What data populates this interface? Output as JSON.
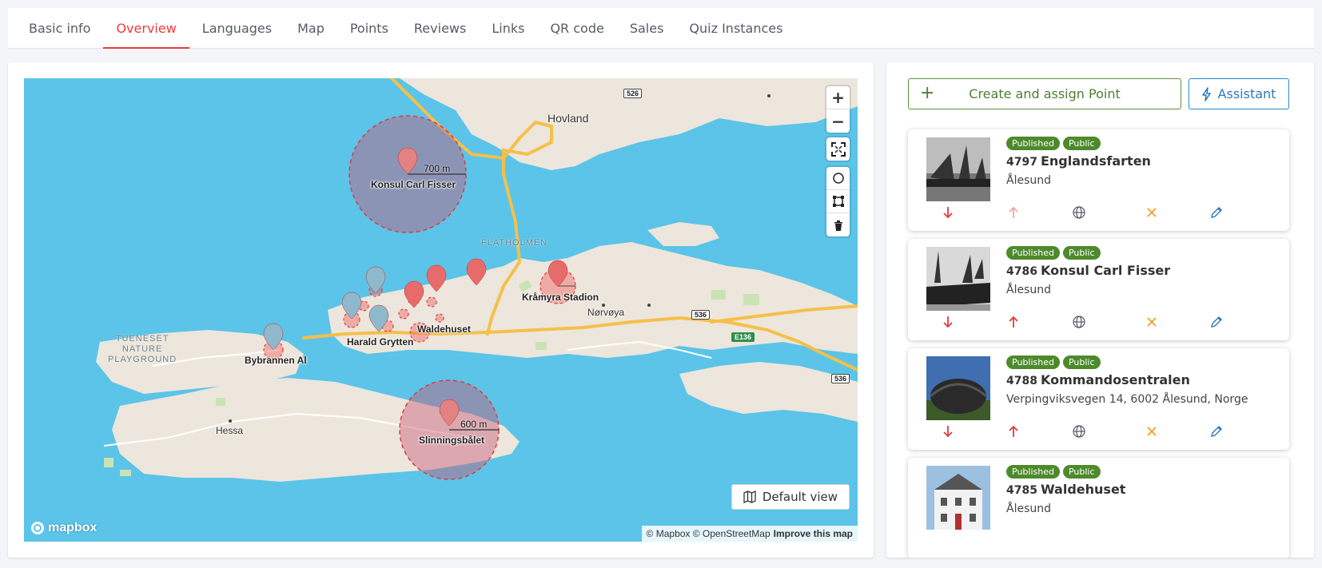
{
  "tabs": [
    {
      "label": "Basic info",
      "active": false
    },
    {
      "label": "Overview",
      "active": true
    },
    {
      "label": "Languages",
      "active": false
    },
    {
      "label": "Map",
      "active": false
    },
    {
      "label": "Points",
      "active": false
    },
    {
      "label": "Reviews",
      "active": false
    },
    {
      "label": "Links",
      "active": false
    },
    {
      "label": "QR code",
      "active": false
    },
    {
      "label": "Sales",
      "active": false
    },
    {
      "label": "Quiz Instances",
      "active": false
    }
  ],
  "map": {
    "default_view_label": "Default view",
    "attribution": "© Mapbox © OpenStreetMap",
    "improve_link": "Improve this map",
    "logo_text": "mapbox",
    "marker_labels": {
      "konsul": "Konsul Carl Fisser",
      "kramyra": "Kråmyra Stadion",
      "waldehuset": "Waldehuset",
      "harald": "Harald Grytten",
      "bybrannen": "Bybrannen Al",
      "slinning": "Slinningsbålet"
    },
    "scale_labels": {
      "konsul": "700 m",
      "slinning": "600 m"
    },
    "place_labels": {
      "hovland": "Hovland",
      "norvoya": "Nørvøya",
      "hessa": "Hessa"
    },
    "area_labels": {
      "flatholmen": "FLATHOLMEN",
      "tueneset_1": "TUENESET",
      "tueneset_2": "NATURE",
      "tueneset_3": "PLAYGROUND"
    },
    "road_shields": {
      "r526": "526",
      "r536a": "536",
      "r536b": "536",
      "e136": "E136",
      "r5": "5"
    }
  },
  "actions": {
    "create_label": "Create and assign Point",
    "assistant_label": "Assistant"
  },
  "points": [
    {
      "id": "4797",
      "name": "Englandsfarten",
      "address": "Ålesund",
      "badges": [
        "Published",
        "Public"
      ]
    },
    {
      "id": "4786",
      "name": "Konsul Carl Fisser",
      "address": "Ålesund",
      "badges": [
        "Published",
        "Public"
      ]
    },
    {
      "id": "4788",
      "name": "Kommandosentralen",
      "address": "Verpingviksvegen 14, 6002 Ålesund, Norge",
      "badges": [
        "Published",
        "Public"
      ]
    },
    {
      "id": "4785",
      "name": "Waldehuset",
      "address": "Ålesund",
      "badges": [
        "Published",
        "Public"
      ]
    }
  ],
  "colors": {
    "accent_red": "#ee3a3a",
    "published_green": "#4e8a2c",
    "assistant_blue": "#2a78b8",
    "water": "#5bc4e8",
    "land": "#ede6dc"
  }
}
